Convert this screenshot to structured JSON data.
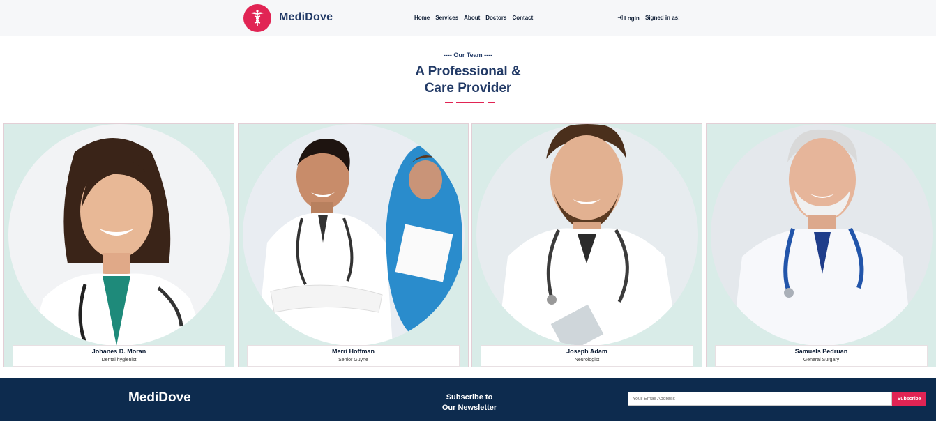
{
  "header": {
    "brand": "MediDove",
    "nav": [
      "Home",
      "Services",
      "About",
      "Doctors",
      "Contact"
    ],
    "login": "Login",
    "signed_in": "Signed in as:"
  },
  "section": {
    "subtitle": "---- Our Team ----",
    "title_line1": "A Professional &",
    "title_line2": "Care Provider"
  },
  "team": [
    {
      "name": "Johanes D. Moran",
      "role": "Dental hygienist"
    },
    {
      "name": "Merri Hoffman",
      "role": "Senior Guyne"
    },
    {
      "name": "Joseph Adam",
      "role": "Neurologist"
    },
    {
      "name": "Samuels Pedruan",
      "role": "General Surgary"
    }
  ],
  "footer": {
    "brand": "MediDove",
    "newsletter_line1": "Subscribe to",
    "newsletter_line2": "Our Newsletter",
    "email_placeholder": "Your Email Address",
    "subscribe": "Subscribe"
  },
  "colors": {
    "accent": "#e12454",
    "navy": "#223a66",
    "footer_bg": "#0d2b4e",
    "card_bg": "#d9ece8"
  },
  "icons": {
    "logo": "caduceus-icon",
    "login": "sign-in-icon"
  }
}
